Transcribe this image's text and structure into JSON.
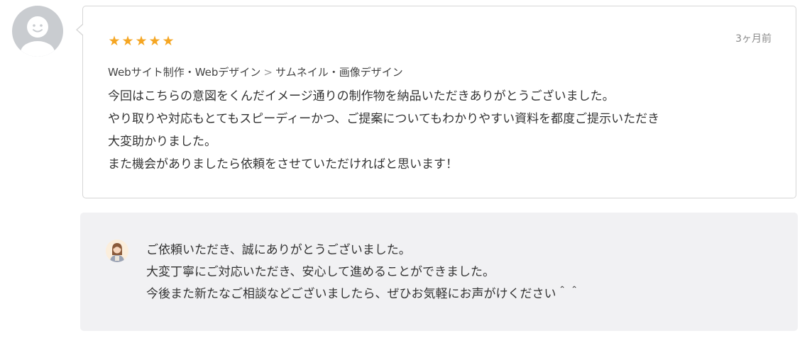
{
  "review": {
    "rating": 5,
    "stars": [
      "★",
      "★",
      "★",
      "★",
      "★"
    ],
    "time_ago": "3ヶ月前",
    "breadcrumb": {
      "category": "Webサイト制作・Webデザイン",
      "separator": ">",
      "subcategory": "サムネイル・画像デザイン"
    },
    "lines": [
      "今回はこちらの意図をくんだイメージ通りの制作物を納品いただきありがとうございました。",
      "やり取りや対応もとてもスピーディーかつ、ご提案についてもわかりやすい資料を都度ご提示いただき",
      "大変助かりました。",
      "また機会がありましたら依頼をさせていただければと思います！"
    ]
  },
  "reply": {
    "lines": [
      "ご依頼いただき、誠にありがとうございました。",
      "大変丁寧にご対応いただき、安心して進めることができました。",
      "今後また新たなご相談などございましたら、ぜひお気軽にお声がけください＾＾"
    ]
  },
  "colors": {
    "star": "#f5a623",
    "card_border": "#d5d5d5",
    "reply_background": "#f1f1f3",
    "avatar_background": "#c9ccd0"
  },
  "icons": {
    "reviewer_avatar": "default-user-avatar-icon",
    "seller_avatar": "seller-avatar-icon",
    "star": "star-icon"
  }
}
